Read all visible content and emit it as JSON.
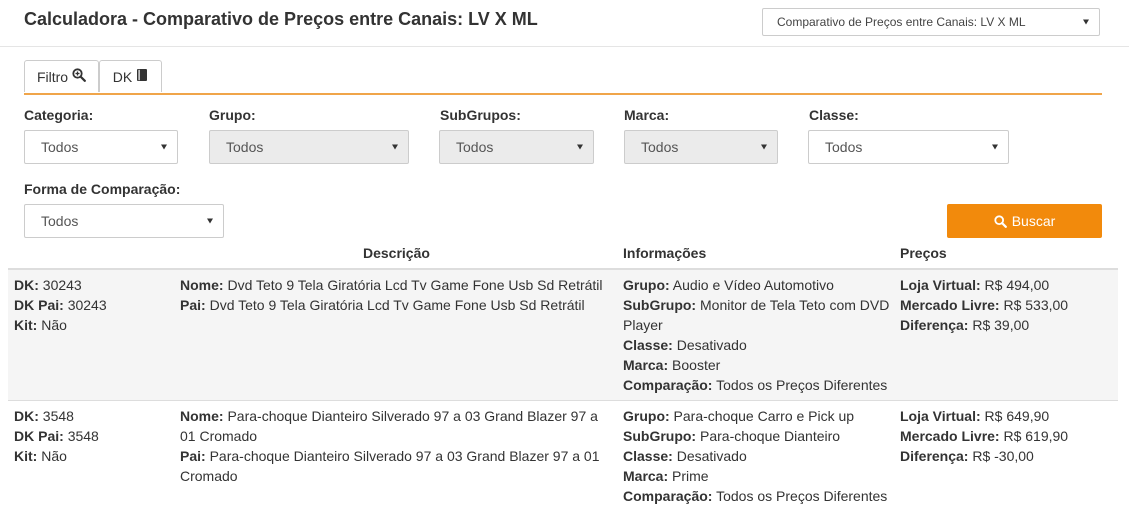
{
  "header": {
    "title": "Calculadora - Comparativo de Preços entre Canais: LV X ML",
    "report_select": "Comparativo de Preços entre Canais: LV X ML"
  },
  "tabs": [
    {
      "label": "Filtro",
      "icon": "zoom-in-icon"
    },
    {
      "label": "DK",
      "icon": "book-icon"
    }
  ],
  "filters": {
    "categoria": {
      "label": "Categoria:",
      "value": "Todos"
    },
    "grupo": {
      "label": "Grupo:",
      "value": "Todos"
    },
    "subgrupos": {
      "label": "SubGrupos:",
      "value": "Todos"
    },
    "marca": {
      "label": "Marca:",
      "value": "Todos"
    },
    "classe": {
      "label": "Classe:",
      "value": "Todos"
    },
    "forma": {
      "label": "Forma de Comparação:",
      "value": "Todos"
    }
  },
  "buscar_label": "Buscar",
  "accent_color": "#f28a0c",
  "table": {
    "headers": {
      "descricao": "Descrição",
      "informacoes": "Informações",
      "precos": "Preços"
    },
    "labels": {
      "dk": "DK:",
      "dk_pai": "DK Pai:",
      "kit": "Kit:",
      "nome": "Nome:",
      "pai": "Pai:",
      "grupo": "Grupo:",
      "subgrupo": "SubGrupo:",
      "classe": "Classe:",
      "marca": "Marca:",
      "comparacao": "Comparação:",
      "loja_virtual": "Loja Virtual:",
      "mercado_livre": "Mercado Livre:",
      "diferenca": "Diferença:"
    },
    "rows": [
      {
        "dk": "30243",
        "dk_pai": "30243",
        "kit": "Não",
        "nome": "Dvd Teto 9 Tela Giratória Lcd Tv Game Fone Usb Sd Retrátil",
        "pai": "Dvd Teto 9 Tela Giratória Lcd Tv Game Fone Usb Sd Retrátil",
        "grupo": "Audio e Vídeo Automotivo",
        "subgrupo": "Monitor de Tela Teto com DVD Player",
        "classe": "Desativado",
        "marca": "Booster",
        "comparacao": "Todos os Preços Diferentes",
        "loja_virtual": "R$ 494,00",
        "mercado_livre": "R$ 533,00",
        "diferenca": "R$ 39,00"
      },
      {
        "dk": "3548",
        "dk_pai": "3548",
        "kit": "Não",
        "nome": "Para-choque Dianteiro Silverado 97 a 03 Grand Blazer 97 a 01 Cromado",
        "pai": "Para-choque Dianteiro Silverado 97 a 03 Grand Blazer 97 a 01 Cromado",
        "grupo": "Para-choque Carro e Pick up",
        "subgrupo": "Para-choque Dianteiro",
        "classe": "Desativado",
        "marca": "Prime",
        "comparacao": "Todos os Preços Diferentes",
        "loja_virtual": "R$ 649,90",
        "mercado_livre": "R$ 619,90",
        "diferenca": "R$ -30,00"
      }
    ]
  }
}
